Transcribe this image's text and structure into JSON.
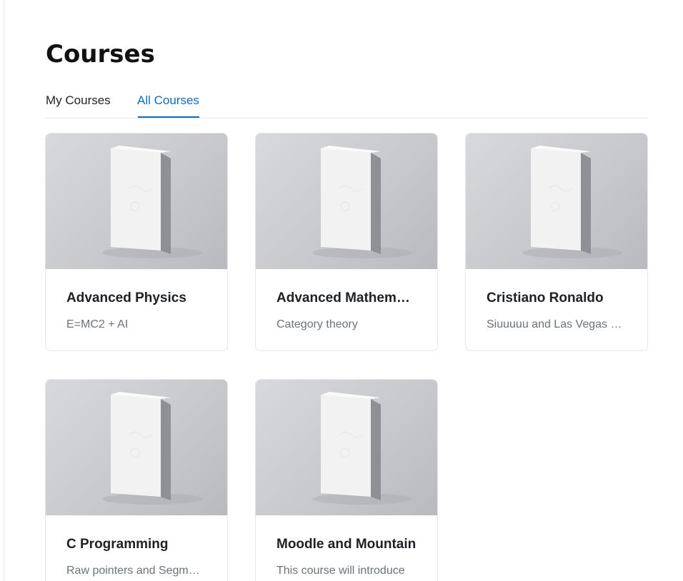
{
  "page": {
    "title": "Courses"
  },
  "tabs": [
    {
      "label": "My Courses",
      "active": false
    },
    {
      "label": "All Courses",
      "active": true
    }
  ],
  "courses": [
    {
      "title": "Advanced Physics",
      "summary": "E=MC2 + AI"
    },
    {
      "title": "Advanced Mathematics",
      "summary": "Category theory"
    },
    {
      "title": "Cristiano Ronaldo",
      "summary": "Siuuuuu and Las Vegas events"
    },
    {
      "title": "C Programming",
      "summary": "Raw pointers and Segmentation faults"
    },
    {
      "title": "Moodle and Mountain",
      "summary": "This course will introduce"
    }
  ],
  "colors": {
    "accent": "#0f6cbf",
    "text": "#1d2125",
    "muted": "#6a737b",
    "border": "#e5e7eb"
  }
}
